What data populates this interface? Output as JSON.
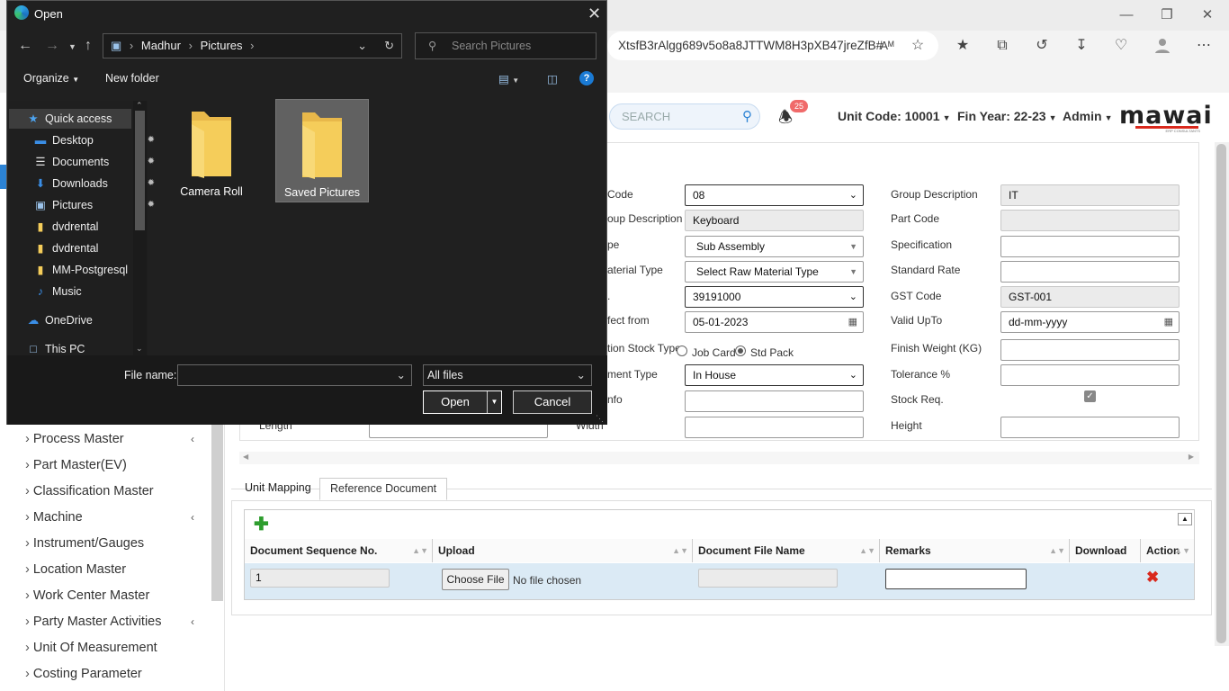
{
  "browser": {
    "url_text": "XtsfB3rAlgg689v5o8a8JTTWM8H3pXB47jreZfB#",
    "window_controls": [
      "minimize-icon",
      "restore-icon",
      "close-icon"
    ],
    "toolbar_icons": [
      "read-aloud-icon",
      "add-favorite-icon",
      "favorites-icon",
      "collections-icon",
      "history-icon",
      "downloads-icon",
      "browser-essentials-icon",
      "profile-icon",
      "more-icon"
    ]
  },
  "app_header": {
    "search_placeholder": "SEARCH",
    "notification_count": "25",
    "unit_code": "Unit Code: 10001",
    "fin_year": "Fin Year: 22-23",
    "user": "Admin",
    "logo_text": "mawai",
    "logo_sub": "ERP CONSULTANTS"
  },
  "sidebar": {
    "items": [
      {
        "label": "Process Master",
        "chevron": true
      },
      {
        "label": "Part Master(EV)",
        "chevron": false
      },
      {
        "label": "Classification Master",
        "chevron": false
      },
      {
        "label": "Machine",
        "chevron": true
      },
      {
        "label": "Instrument/Gauges",
        "chevron": false
      },
      {
        "label": "Location Master",
        "chevron": false
      },
      {
        "label": "Work Center Master",
        "chevron": false
      },
      {
        "label": "Party Master Activities",
        "chevron": true
      },
      {
        "label": "Unit Of Measurement",
        "chevron": false
      },
      {
        "label": "Costing Parameter",
        "chevron": false
      }
    ]
  },
  "form": {
    "group_code_label": "Code",
    "group_code_value": "08",
    "group_desc_label": "Group Description",
    "group_desc_value": "IT",
    "sub_group_desc_label": "oup Description",
    "sub_group_desc_value": "Keyboard",
    "part_code_label": "Part Code",
    "part_code_value": "",
    "type_label": "pe",
    "type_value": "Sub Assembly",
    "specification_label": "Specification",
    "raw_material_label": "aterial Type",
    "raw_material_value": "Select Raw Material Type",
    "standard_rate_label": "Standard Rate",
    "hsn_label": ".",
    "hsn_value": "39191000",
    "gst_code_label": "GST Code",
    "gst_code_value": "GST-001",
    "effect_from_label": "fect from",
    "effect_from_value": "05-01-2023",
    "valid_upto_label": "Valid UpTo",
    "valid_upto_value": "dd-mm-yyyy",
    "stock_type_label": "tion Stock Type",
    "radio_job_card": "Job Card",
    "radio_std_pack": "Std Pack",
    "finish_weight_label": "Finish Weight (KG)",
    "procurement_label": "ment Type",
    "procurement_value": "In House",
    "tolerance_label": "Tolerance %",
    "info_label": "nfo",
    "stock_req_label": "Stock Req.",
    "length_label": "Length",
    "width_label": "Width",
    "height_label": "Height"
  },
  "tabs": [
    {
      "label": "Unit Mapping",
      "active": false
    },
    {
      "label": "Reference Document",
      "active": true
    }
  ],
  "doc_grid": {
    "columns": [
      "Document Sequence No.",
      "Upload",
      "Document File Name",
      "Remarks",
      "Download",
      "Action"
    ],
    "row": {
      "seq": "1",
      "choose_file": "Choose File",
      "no_file": "No file chosen",
      "file_name": "",
      "remarks": ""
    }
  },
  "dialog": {
    "title": "Open",
    "breadcrumb": [
      "Madhur",
      "Pictures"
    ],
    "search_placeholder": "Search Pictures",
    "organize": "Organize",
    "new_folder": "New folder",
    "nav": [
      {
        "label": "Quick access",
        "icon": "star-icon",
        "pinned": false
      },
      {
        "label": "Desktop",
        "icon": "desktop-icon",
        "pinned": true
      },
      {
        "label": "Documents",
        "icon": "documents-icon",
        "pinned": true
      },
      {
        "label": "Downloads",
        "icon": "download-icon",
        "pinned": true
      },
      {
        "label": "Pictures",
        "icon": "pictures-icon",
        "pinned": true
      },
      {
        "label": "dvdrental",
        "icon": "file-icon",
        "pinned": false
      },
      {
        "label": "dvdrental",
        "icon": "file-icon",
        "pinned": false
      },
      {
        "label": "MM-Postgresql",
        "icon": "file-icon",
        "pinned": false
      },
      {
        "label": "Music",
        "icon": "music-icon",
        "pinned": false
      },
      {
        "label": "OneDrive",
        "icon": "cloud-icon",
        "pinned": false
      },
      {
        "label": "This PC",
        "icon": "pc-icon",
        "pinned": false
      }
    ],
    "folders": [
      {
        "label": "Camera Roll",
        "selected": false
      },
      {
        "label": "Saved Pictures",
        "selected": true
      }
    ],
    "file_name_label": "File name:",
    "file_name_value": "",
    "file_type": "All files",
    "open_btn": "Open",
    "cancel_btn": "Cancel"
  },
  "colors": {
    "accent": "#2c83d4",
    "dialog_bg": "#202020",
    "folder": "#f5cd5a",
    "grid_row": "#dbeaf5",
    "badge": "#f06a6a",
    "delete": "#d9281c",
    "add": "#2e9d2e"
  }
}
